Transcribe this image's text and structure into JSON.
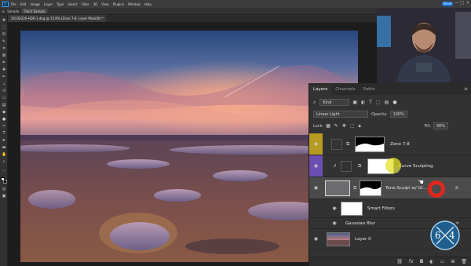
{
  "menubar": {
    "logo": "Ps",
    "items": [
      "File",
      "Edit",
      "Image",
      "Layer",
      "Type",
      "Select",
      "Filter",
      "3D",
      "View",
      "Plugins",
      "Window",
      "Help"
    ],
    "share_label": "Share",
    "min": "—",
    "max": "□",
    "close": "✕"
  },
  "options": {
    "sample_label": "Sample",
    "sample_value": "Point Sample"
  },
  "document": {
    "tab_label": "20230226-HDR-1.dng @ 15.8% (Zone 7-8, Layer Mask/8) *"
  },
  "layers_panel": {
    "tabs": [
      "Layers",
      "Channels",
      "Paths"
    ],
    "active_tab": "Layers",
    "filter_kind": "Kind",
    "blend_mode": "Linear Light",
    "opacity_label": "Opacity:",
    "opacity_value": "100%",
    "lock_label": "Lock:",
    "fill_label": "Fill:",
    "fill_value": "30%",
    "layers": [
      {
        "name": "Zone 7-8",
        "eye_color": "#b79a22"
      },
      {
        "name": "Curve Sculpting",
        "eye_color": "#6a4fb0"
      },
      {
        "name": "Tone Sculpt w/ Gl...",
        "eye_color": "#3a3a3a"
      },
      {
        "name": "Smart Filters"
      },
      {
        "name": "Gaussian Blur"
      },
      {
        "name": "Layer 0"
      }
    ],
    "footer_icons": [
      "link-icon",
      "fx-icon",
      "mask-icon",
      "adjustment-icon",
      "group-icon",
      "new-layer-icon",
      "trash-icon"
    ]
  },
  "watermark": {
    "left_digit": "6",
    "right_digit": "4"
  },
  "colors": {
    "accent": "#31a8ff",
    "share": "#1473e6",
    "zone_color": "#b79a22",
    "curve_color": "#6a4fb0",
    "ring": "#e0261f"
  }
}
